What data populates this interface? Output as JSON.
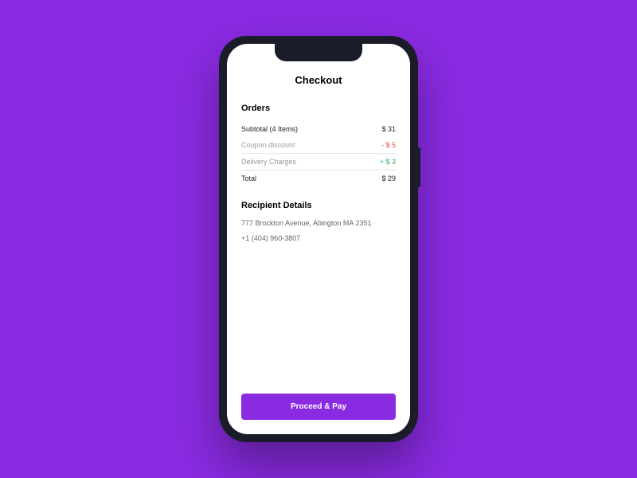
{
  "header": {
    "title": "Checkout"
  },
  "orders": {
    "section_title": "Orders",
    "rows": [
      {
        "label": "Subtotal (4 Items)",
        "value": "$ 31"
      },
      {
        "label": "Coupon discount",
        "value": "- $ 5"
      },
      {
        "label": "Delivery Charges",
        "value": "+ $ 3"
      },
      {
        "label": "Total",
        "value": "$ 29"
      }
    ]
  },
  "recipient": {
    "section_title": "Recipient Details",
    "address": "777 Brockton Avenue, Abington MA 2351",
    "phone": "+1 (404) 960-3807"
  },
  "actions": {
    "proceed_label": "Proceed & Pay"
  },
  "colors": {
    "background": "#8a2be2",
    "accent": "#8a2be2",
    "discount": "#e74c3c",
    "charge": "#27ae60"
  }
}
